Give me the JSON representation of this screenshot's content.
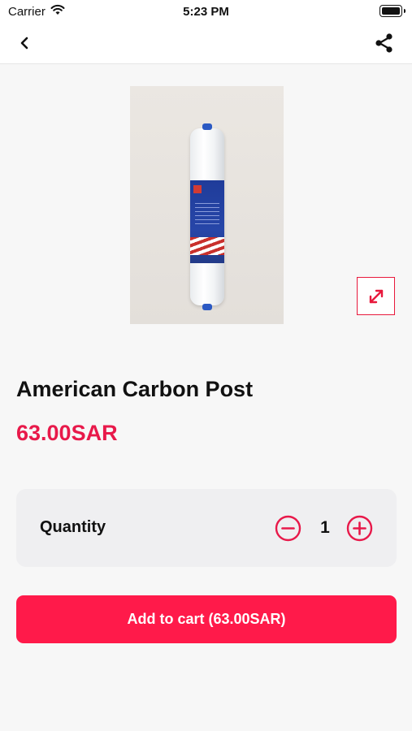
{
  "status_bar": {
    "carrier": "Carrier",
    "time": "5:23 PM"
  },
  "nav": {
    "back_icon": "chevron-left-icon",
    "share_icon": "share-icon"
  },
  "product": {
    "name": "American Carbon Post",
    "price": "63.00SAR",
    "image_icon": "water-filter-cartridge"
  },
  "quantity": {
    "label": "Quantity",
    "value": "1"
  },
  "cart": {
    "button_label": "Add to cart (63.00SAR)"
  },
  "colors": {
    "accent": "#e8194a",
    "button": "#ff1a4a",
    "card": "#efeff1",
    "background": "#f7f7f7"
  }
}
